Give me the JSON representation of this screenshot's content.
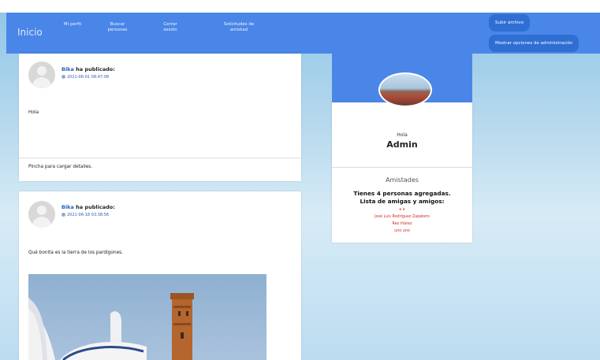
{
  "nav": {
    "brand": "Inicio",
    "items": [
      "Mi perfil",
      "Buscar personas",
      "Cerrar sesión",
      "Solicitudes de amistad"
    ],
    "right_buttons": [
      "Subir archivo",
      "Mostrar opciones de administración"
    ]
  },
  "posts": [
    {
      "author": "Bika",
      "verb": "ha publicado:",
      "date": "2021-06-01 08:47:08",
      "text": "Hola",
      "footer": "Pincha para cargar detalles."
    },
    {
      "author": "Bika",
      "verb": "ha publicado:",
      "date": "2021-06-18 03:38:56",
      "text": "Qué bonita es la tierra de los pardigones."
    }
  ],
  "profile": {
    "greeting": "Hola",
    "name": "Admin",
    "friends_title": "Amistades",
    "friends_count": "Tienes 4 personas agregadas.",
    "friends_list_title": "Lista de amigas y amigos:",
    "friends": [
      "a a",
      "José Luis Rodríguez Zapatero",
      "Rex Iñárez",
      "uno uno"
    ]
  },
  "colors": {
    "accent": "#4a86e8",
    "accent_dark": "#2f6fd3",
    "link_red": "#d22a1e"
  }
}
